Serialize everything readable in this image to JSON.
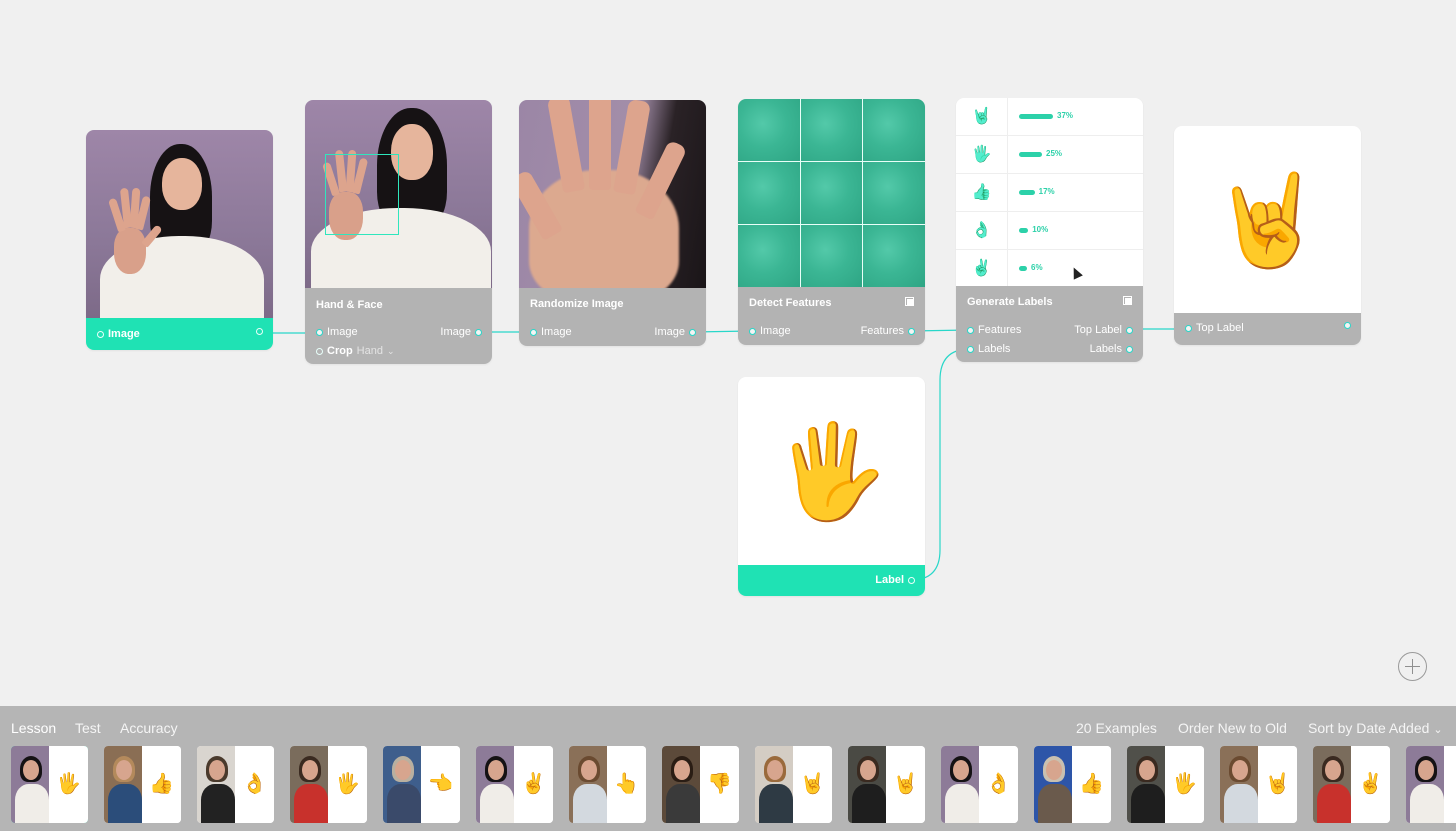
{
  "nodes": {
    "image_input": {
      "output_label": "Image"
    },
    "hand_face": {
      "title": "Hand & Face",
      "input_label": "Image",
      "output_label": "Image",
      "crop_label": "Crop",
      "crop_value": "Hand",
      "crop_chevron": "⌄"
    },
    "randomize": {
      "title": "Randomize Image",
      "input_label": "Image",
      "output_label": "Image"
    },
    "detect": {
      "title": "Detect Features",
      "input_label": "Image",
      "output_label": "Features"
    },
    "generate": {
      "title": "Generate Labels",
      "input_features": "Features",
      "input_labels": "Labels",
      "output_top": "Top Label",
      "output_labels": "Labels",
      "predictions": [
        {
          "emoji": "🤘",
          "value": 37,
          "text": "37%"
        },
        {
          "emoji": "🖐",
          "value": 25,
          "text": "25%"
        },
        {
          "emoji": "👍",
          "value": 17,
          "text": "17%"
        },
        {
          "emoji": "👌",
          "value": 10,
          "text": "10%"
        },
        {
          "emoji": "✌",
          "value": 6,
          "text": "6%"
        }
      ]
    },
    "top_label": {
      "emoji": "🤘",
      "output_label": "Top Label"
    },
    "label": {
      "emoji": "🖐",
      "output_label": "Label"
    }
  },
  "colors": {
    "accent": "#1fe2b4",
    "wire": "#28d7c9",
    "node_footer": "#b3b3b3",
    "bottom_bar": "#b5b5b5"
  },
  "bottombar": {
    "tabs": [
      "Lesson",
      "Test",
      "Accuracy"
    ],
    "active_tab": "Lesson",
    "examples_count": "20 Examples",
    "order": "Order New to Old",
    "sort": "Sort by Date Added",
    "sort_chevron": "⌄",
    "examples": [
      {
        "emoji": "🖐",
        "bg": "#8d7b98",
        "hair": "#151214",
        "body": "#f0ede8"
      },
      {
        "emoji": "👍",
        "bg": "#8a6e54",
        "hair": "#b48a5c",
        "body": "#2b4d7a"
      },
      {
        "emoji": "👌",
        "bg": "#d9d5cf",
        "hair": "#4a3a2c",
        "body": "#222"
      },
      {
        "emoji": "🖐",
        "bg": "#7a6c5c",
        "hair": "#3a2a20",
        "body": "#c8312c"
      },
      {
        "emoji": "👈",
        "bg": "#3e5e8c",
        "hair": "#b9b0a0",
        "body": "#3a4a6a"
      },
      {
        "emoji": "✌",
        "bg": "#8d7b98",
        "hair": "#151214",
        "body": "#f0ede8"
      },
      {
        "emoji": "👆",
        "bg": "#8a7058",
        "hair": "#6a4a30",
        "body": "#d3d9df"
      },
      {
        "emoji": "👎",
        "bg": "#5c4a3a",
        "hair": "#2a1d14",
        "body": "#3a3a3a"
      },
      {
        "emoji": "🤘",
        "bg": "#d4cdc4",
        "hair": "#9a6a3c",
        "body": "#2e3a44"
      },
      {
        "emoji": "🤘",
        "bg": "#4a4a44",
        "hair": "#3a2a20",
        "body": "#1e1e1e"
      },
      {
        "emoji": "👌",
        "bg": "#8d7b98",
        "hair": "#151214",
        "body": "#f0ede8"
      },
      {
        "emoji": "👍",
        "bg": "#2d55a8",
        "hair": "#c9c0b0",
        "body": "#6a5a4c"
      },
      {
        "emoji": "🖐",
        "bg": "#50504a",
        "hair": "#3a2a20",
        "body": "#1e1e1e"
      },
      {
        "emoji": "🤘",
        "bg": "#8a7058",
        "hair": "#6a4a30",
        "body": "#d3d9df"
      },
      {
        "emoji": "✌",
        "bg": "#7a6c5c",
        "hair": "#3a2a20",
        "body": "#c8312c"
      },
      {
        "emoji": "",
        "bg": "#8d7b98",
        "hair": "#151214",
        "body": "#f0ede8"
      }
    ]
  }
}
